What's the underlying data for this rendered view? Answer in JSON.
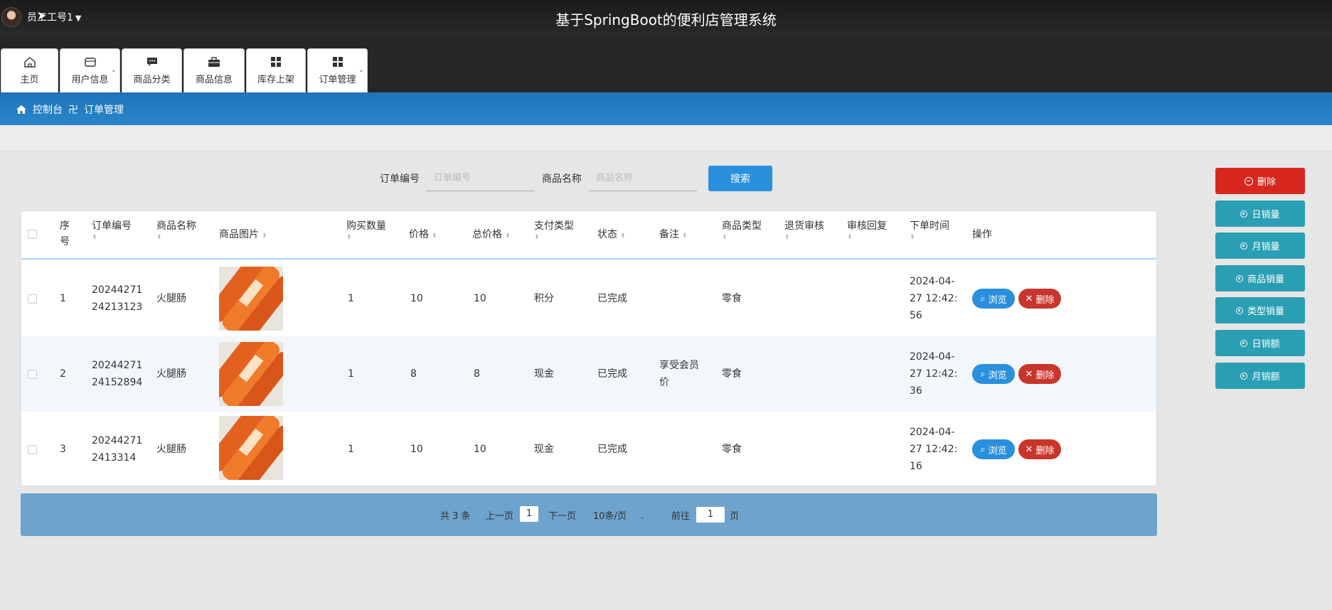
{
  "header": {
    "user_label": "员工工号1",
    "system_title": "基于SpringBoot的便利店管理系统"
  },
  "nav": [
    {
      "label": "主页",
      "icon": "home-icon",
      "dropdown": false
    },
    {
      "label": "用户信息",
      "icon": "wallet-icon",
      "dropdown": true
    },
    {
      "label": "商品分类",
      "icon": "chat-icon",
      "dropdown": false
    },
    {
      "label": "商品信息",
      "icon": "briefcase-icon",
      "dropdown": false
    },
    {
      "label": "库存上架",
      "icon": "grid-icon",
      "dropdown": false
    },
    {
      "label": "订单管理",
      "icon": "grid-icon",
      "dropdown": true
    }
  ],
  "breadcrumb": {
    "home": "控制台",
    "separator": "卍",
    "current": "订单管理"
  },
  "search": {
    "order_no_label": "订单编号",
    "order_no_placeholder": "订单编号",
    "order_no_value": "",
    "product_name_label": "商品名称",
    "product_name_placeholder": "商品名称",
    "product_name_value": "",
    "button": "搜索"
  },
  "table": {
    "headers": {
      "index_a": "序",
      "index_b": "号",
      "order_no": "订单编号",
      "product_name": "商品名称",
      "product_image": "商品图片",
      "quantity": "购买数量",
      "price": "价格",
      "total": "总价格",
      "payment": "支付类型",
      "status": "状态",
      "remark": "备注",
      "category": "商品类型",
      "return_review": "退货审核",
      "review_reply": "审核回复",
      "order_time": "下单时间",
      "actions": "操作"
    },
    "rows": [
      {
        "index": "1",
        "order_no_a": "20244271",
        "order_no_b": "24213123",
        "product_name": "火腿肠",
        "quantity": "1",
        "price": "10",
        "total": "10",
        "payment": "积分",
        "status": "已完成",
        "remark_a": "",
        "remark_b": "",
        "category": "零食",
        "return_review": "",
        "review_reply": "",
        "time_a": "2024-04-",
        "time_b": "27 12:42:",
        "time_c": "56"
      },
      {
        "index": "2",
        "order_no_a": "20244271",
        "order_no_b": "24152894",
        "product_name": "火腿肠",
        "quantity": "1",
        "price": "8",
        "total": "8",
        "payment": "现金",
        "status": "已完成",
        "remark_a": "享受会员",
        "remark_b": "价",
        "category": "零食",
        "return_review": "",
        "review_reply": "",
        "time_a": "2024-04-",
        "time_b": "27 12:42:",
        "time_c": "36"
      },
      {
        "index": "3",
        "order_no_a": "20244271",
        "order_no_b": "2413314",
        "product_name": "火腿肠",
        "quantity": "1",
        "price": "10",
        "total": "10",
        "payment": "现金",
        "status": "已完成",
        "remark_a": "",
        "remark_b": "",
        "category": "零食",
        "return_review": "",
        "review_reply": "",
        "time_a": "2024-04-",
        "time_b": "27 12:42:",
        "time_c": "16"
      }
    ],
    "view_label": "浏览",
    "delete_label": "删除"
  },
  "pagination": {
    "total": "共 3 条",
    "prev": "上一页",
    "current_page": "1",
    "next": "下一页",
    "page_size": "10条/页",
    "goto_label": "前往",
    "goto_value": "1",
    "page_unit": "页"
  },
  "side_buttons": {
    "delete": "删除",
    "daily_sales": "日销量",
    "monthly_sales": "月销量",
    "product_sales": "商品销量",
    "type_sales": "类型销量",
    "daily_revenue": "日销额",
    "monthly_revenue": "月销额"
  },
  "colors": {
    "topbar": "#1b1b1b",
    "breadcrumb": "#2178bd",
    "primary": "#2a8fdc",
    "danger": "#d8271f",
    "teal": "#2a9fb4",
    "pager": "#6ea3cd"
  }
}
